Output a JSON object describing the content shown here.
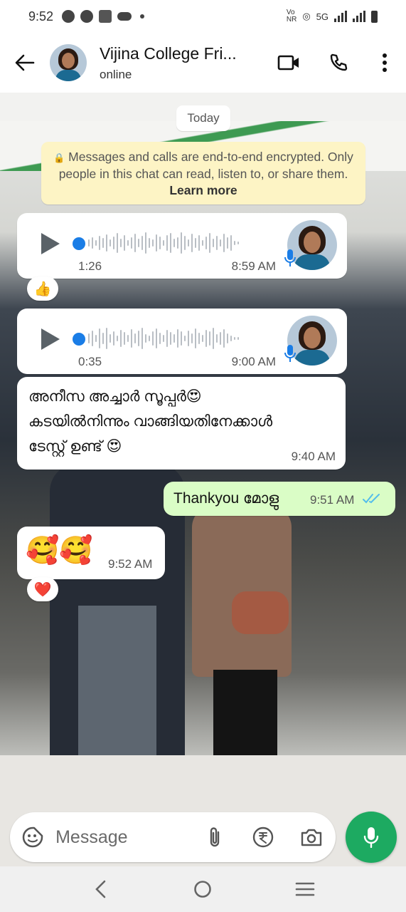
{
  "status_bar": {
    "time": "9:52",
    "network": "5G"
  },
  "header": {
    "title": "Vijina College Fri...",
    "subtitle": "online"
  },
  "chat": {
    "date_chip": "Today",
    "encryption_note": {
      "text": "Messages and calls are end-to-end encrypted. Only people in this chat can read, listen to, or share them.",
      "link": "Learn more"
    },
    "messages": [
      {
        "type": "voice",
        "direction": "in",
        "duration": "1:26",
        "time": "8:59 AM",
        "reaction": "👍"
      },
      {
        "type": "voice",
        "direction": "in",
        "duration": "0:35",
        "time": "9:00 AM"
      },
      {
        "type": "text",
        "direction": "in",
        "text": "അനീസ അച്ചാർ സൂപ്പർ😍 കടയിൽനിന്നും വാങ്ങിയതിനേക്കാൾ ടേസ്റ്റ് ഉണ്ട് 😍",
        "time": "9:40 AM"
      },
      {
        "type": "text",
        "direction": "out",
        "text": "Thankyou മോളു",
        "time": "9:51 AM",
        "status": "read"
      },
      {
        "type": "text",
        "direction": "in",
        "text": "🥰🥰",
        "time": "9:52 AM",
        "reaction": "❤️"
      }
    ]
  },
  "composer": {
    "placeholder": "Message"
  },
  "colors": {
    "accent_green": "#1daa61",
    "outgoing_bubble": "#dafdc6",
    "encryption_bg": "#fdf4c5",
    "read_ticks": "#53bdeb"
  }
}
